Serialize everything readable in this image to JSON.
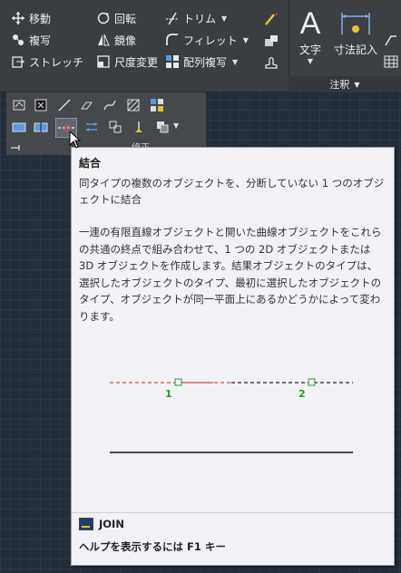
{
  "ribbon": {
    "modify_row1": [
      {
        "label": "移動",
        "icon": "move-icon"
      },
      {
        "label": "回転",
        "icon": "rotate-icon"
      },
      {
        "label": "トリム",
        "icon": "trim-icon"
      }
    ],
    "modify_row2": [
      {
        "label": "複写",
        "icon": "copy-icon"
      },
      {
        "label": "鏡像",
        "icon": "mirror-icon"
      },
      {
        "label": "フィレット",
        "icon": "fillet-icon"
      }
    ],
    "modify_row3": [
      {
        "label": "ストレッチ",
        "icon": "stretch-icon"
      },
      {
        "label": "尺度変更",
        "icon": "scale-icon"
      },
      {
        "label": "配列複写",
        "icon": "array-icon"
      }
    ],
    "text_label": "文字",
    "dimension_label": "寸法記入",
    "annotation_panel_label": "注釈",
    "big_a": "A"
  },
  "flyout": {
    "label": "修正"
  },
  "tooltip": {
    "title": "結合",
    "summary": "同タイプの複数のオブジェクトを、分断していない 1 つのオブジェクトに結合",
    "detail": "一連の有限直線オブジェクトと開いた曲線オブジェクトをこれらの共通の終点で組み合わせて、1 つの 2D オブジェクトまたは 3D オブジェクトを作成します。結果オブジェクトのタイプは、選択したオブジェクトのタイプ、最初に選択したオブジェクトのタイプ、オブジェクトが同一平面上にあるかどうかによって変わります。",
    "diagram": {
      "point1": "1",
      "point2": "2"
    },
    "command": "JOIN",
    "help": "ヘルプを表示するには F1 キー"
  },
  "colors": {
    "ribbon_bg": "#3a3d42",
    "tooltip_bg": "#f1f2f6",
    "dash_red": "#d94a4a",
    "marker_green": "#2a9a2a"
  }
}
